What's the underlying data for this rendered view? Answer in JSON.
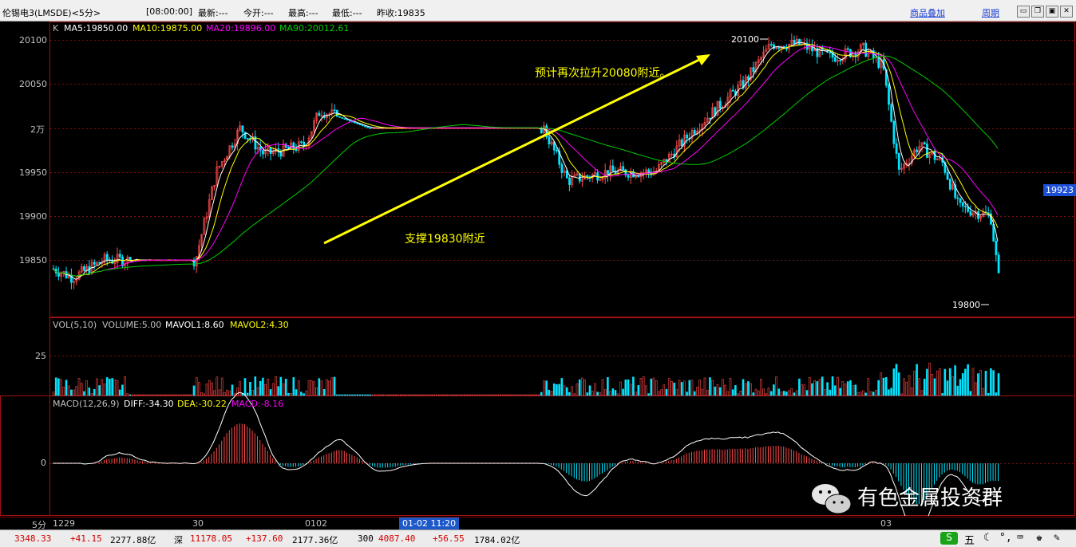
{
  "topbar": {
    "title": "伦锡电3(LMSDE)<5分>",
    "time": "[08:00:00]",
    "latest": "最新:---",
    "open": "今开:---",
    "high": "最高:---",
    "low": "最低:---",
    "prev_close": "昨收:19835",
    "overlay_link": "商品叠加",
    "period_link": "周期"
  },
  "kline": {
    "legend_k": "K",
    "ma5": "MA5:19850.00",
    "ma10": "MA10:19875.00",
    "ma20": "MA20:19896.00",
    "ma90": "MA90:20012.61",
    "y_ticks": [
      "20100",
      "20050",
      "2万",
      "19950",
      "19900",
      "19850"
    ],
    "high_mark": "20100",
    "low_mark": "19800",
    "current_price": "19923",
    "annotation_up": "预计再次拉升20080附近。",
    "annotation_support": "支撑19830附近",
    "colors": {
      "ma5": "#ffffff",
      "ma10": "#ffff00",
      "ma20": "#ff00ff",
      "ma90": "#00cc00",
      "up": "#ff4a4a",
      "down": "#00e5ff",
      "arrow": "#ffff00"
    }
  },
  "volume": {
    "title": "VOL(5,10)",
    "volume": "VOLUME:5.00",
    "mavol1": "MAVOL1:8.60",
    "mavol2": "MAVOL2:4.30",
    "y_tick": "25"
  },
  "macd": {
    "title": "MACD(12,26,9)",
    "diff": "DIFF:-34.30",
    "dea": "DEA:-30.22",
    "macd": "MACD:-8.16",
    "y_tick": "0"
  },
  "time_axis": {
    "period": "5分",
    "labels": [
      "1229",
      "30",
      "0102",
      "03"
    ],
    "cursor": "01-02 11:20"
  },
  "watermark": "有色金属投资群",
  "status": {
    "sh_value": "3348.33",
    "sh_change": "+41.15",
    "sh_amount": "2277.88亿",
    "sz_label": "深",
    "sz_value": "11178.05",
    "sz_change": "+137.60",
    "sz_amount": "2177.36亿",
    "idx300_label": "300",
    "idx300_value": "4087.40",
    "idx300_change": "+56.55",
    "idx300_amount": "1784.02亿",
    "ime": "五"
  }
}
